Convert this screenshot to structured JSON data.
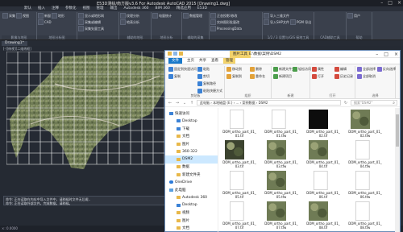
{
  "cad": {
    "title": "E53D测绘/南方版v3.6 For Autodesk AutoCAD 2015   [Drawing1.dwg]",
    "menu": [
      "默认",
      "插入",
      "注释",
      "参数化",
      "视图",
      "管理",
      "输出",
      "Autodesk 360",
      "BIM 360",
      "精选应用",
      "E53D"
    ],
    "ribbon_groups": [
      {
        "label": "影像与地形",
        "items": [
          "采集",
          "视图"
        ]
      },
      {
        "label": "地形分析图",
        "items": [
          "新窗",
          "地形",
          "CAD"
        ]
      },
      {
        "label": "",
        "items": [
          "显示或地形网",
          "采集或编辑",
          "采集矢量工具"
        ]
      },
      {
        "label": "辅助的地形",
        "items": [
          "纹理分析",
          "地表分析"
        ]
      },
      {
        "label": "地形分析",
        "items": [
          "电量统计"
        ]
      },
      {
        "label": "辅助的采集",
        "items": [
          "数据管理"
        ]
      },
      {
        "label": "",
        "items": [
          "正态投影/修改",
          "实体图形批量改",
          "ProcessingData"
        ]
      },
      {
        "label": "1/2 / 3 设置与/GIS 接地工具",
        "items": [
          "导入三维文件",
          "导入SHP文件",
          "PGM 导出"
        ]
      },
      {
        "label": "CAD辅助工具",
        "items": []
      },
      {
        "label": "帮助",
        "items": [
          "用户"
        ]
      }
    ],
    "drawing_tab": "Drawing1*",
    "viewport_label": "[-][俯视][二维线框]",
    "command_lines": [
      "命令: 正在读取在内存中导入文件中，请稍候时文件无后缀..",
      "命令: 正在读取外部文件。完成数据。请稍候。"
    ],
    "coords": "×: 0.0000"
  },
  "explorer": {
    "context_tab": "图片工具",
    "path_title": "E:\\数据\\案例\\DSM2",
    "tabs": [
      "文件",
      "主页",
      "共享",
      "查看",
      "管理"
    ],
    "ribbon_groups": [
      {
        "label": "剪贴板",
        "items": [
          "固定到快速访问",
          "复制",
          "粘贴",
          "剪切",
          "复制路径",
          "粘贴快捷方式"
        ]
      },
      {
        "label": "组织",
        "items": [
          "移动到",
          "复制到",
          "删除",
          "重命名"
        ]
      },
      {
        "label": "新建",
        "items": [
          "新建文件夹",
          "新建项目",
          "轻松访问"
        ]
      },
      {
        "label": "打开",
        "items": [
          "属性",
          "打开",
          "编辑",
          "历史记录"
        ]
      },
      {
        "label": "选择",
        "items": [
          "全部选择",
          "全部取消",
          "反向选择"
        ]
      }
    ],
    "address": "此电脑 › 本地磁盘 (E:) › ... › 案例数据 › DSM2",
    "search_placeholder": "搜索\"DSM2\"",
    "nav": [
      {
        "label": "快速访问",
        "icon": "star-icon",
        "type": "blue",
        "indent": false
      },
      {
        "label": "Desktop",
        "icon": "folder-icon",
        "type": "blue",
        "indent": true
      },
      {
        "label": "下载",
        "icon": "download-icon",
        "type": "blue",
        "indent": true
      },
      {
        "label": "文档",
        "icon": "document-icon",
        "type": "folder",
        "indent": true
      },
      {
        "label": "图片",
        "icon": "picture-icon",
        "type": "folder",
        "indent": true
      },
      {
        "label": "360-322",
        "icon": "folder-icon",
        "type": "folder",
        "indent": true
      },
      {
        "label": "DSM2",
        "icon": "folder-icon",
        "type": "folder",
        "indent": true
      },
      {
        "label": "数据",
        "icon": "folder-icon",
        "type": "folder",
        "indent": true
      },
      {
        "label": "新建文件夹",
        "icon": "folder-icon",
        "type": "folder",
        "indent": true
      },
      {
        "label": "OneDrive",
        "icon": "cloud-icon",
        "type": "cloud",
        "indent": false
      },
      {
        "label": "此电脑",
        "icon": "pc-icon",
        "type": "pc",
        "indent": false
      },
      {
        "label": "Autodesk 360",
        "icon": "folder-icon",
        "type": "folder",
        "indent": true
      },
      {
        "label": "Desktop",
        "icon": "folder-icon",
        "type": "blue",
        "indent": true
      },
      {
        "label": "视频",
        "icon": "video-icon",
        "type": "folder",
        "indent": true
      },
      {
        "label": "图片",
        "icon": "picture-icon",
        "type": "folder",
        "indent": true
      },
      {
        "label": "文档",
        "icon": "document-icon",
        "type": "folder",
        "indent": true
      }
    ],
    "files": [
      {
        "name": "DOM_ortho_part_01_01.tif",
        "tone": "blank"
      },
      {
        "name": "DOM_ortho_part_01_01.tfw",
        "tone": "doc"
      },
      {
        "name": "DOM_ortho_part_01_02.tif",
        "tone": "dark"
      },
      {
        "name": "DOM_ortho_part_01_02.tfw",
        "tone": "aerial"
      },
      {
        "name": "DOM_ortho_part_01_03.tif",
        "tone": "darkaerial"
      },
      {
        "name": "DOM_ortho_part_01_03.tfw",
        "tone": "aerial"
      },
      {
        "name": "DOM_ortho_part_01_04.tif",
        "tone": "aerial"
      },
      {
        "name": "DOM_ortho_part_01_04.tfw",
        "tone": "doc"
      },
      {
        "name": "DOM_ortho_part_01_05.tif",
        "tone": "doc"
      },
      {
        "name": "DOM_ortho_part_01_05.tfw",
        "tone": "aerial"
      },
      {
        "name": "DOM_ortho_part_01_06.tif",
        "tone": "doc"
      },
      {
        "name": "DOM_ortho_part_01_06.tfw",
        "tone": "doc"
      },
      {
        "name": "DOM_ortho_part_01_07.tif",
        "tone": "doc"
      },
      {
        "name": "DOM_ortho_part_01_07.tfw",
        "tone": "aerial"
      },
      {
        "name": "DOM_ortho_part_01_08.tif",
        "tone": "aerial"
      },
      {
        "name": "DOM_ortho_part_01_08.tfw",
        "tone": "doc"
      }
    ],
    "status": "32 个项目"
  },
  "colors": {
    "accent_blue": "#1979ca",
    "context_yellow": "#f3d36b",
    "cad_bg": "#232833",
    "grid_line": "#ffffff"
  }
}
